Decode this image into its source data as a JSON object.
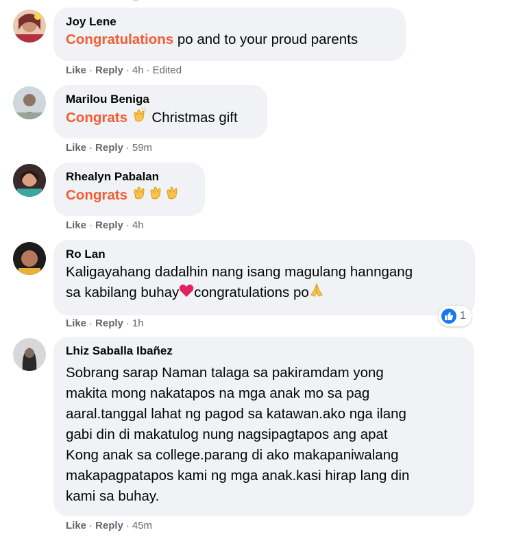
{
  "comments": [
    {
      "author": "Joy Lene",
      "highlight": "Congratulations",
      "text_after": " po and to your proud parents",
      "like": "Like",
      "reply": "Reply",
      "time": "4h",
      "edited": "Edited"
    },
    {
      "author": "Marilou Beniga",
      "highlight": "Congrats",
      "text_after": "Christmas gift",
      "like": "Like",
      "reply": "Reply",
      "time": "59m"
    },
    {
      "author": "Rhealyn Pabalan",
      "highlight": "Congrats",
      "like": "Like",
      "reply": "Reply",
      "time": "4h"
    },
    {
      "author": "Ro Lan",
      "line1": "Kaligayahang dadalhin nang isang magulang hanngang",
      "line2a": "sa kabilang buhay",
      "line2b": "congratulations po",
      "like": "Like",
      "reply": "Reply",
      "time": "1h",
      "reaction_count": "1"
    },
    {
      "author": "Lhiz Saballa Ibañez",
      "lines": [
        "Sobrang sarap Naman talaga sa pakiramdam yong",
        "makita mong nakatapos na mga anak mo sa pag",
        "aaral.tanggal lahat ng pagod sa katawan.ako nga ilang",
        "gabi din di makatulog nung nagsipagtapos ang apat",
        "Kong anak sa college.parang di ako makapaniwalang",
        "makapagpatapos kami ng mga anak.kasi hirap lang din",
        "kami sa buhay."
      ],
      "like": "Like",
      "reply": "Reply",
      "time": "45m"
    }
  ],
  "colors": {
    "highlight": "#f25c33",
    "bubble": "#f0f2f5",
    "meta": "#65676b",
    "like_blue": "#1877f2"
  },
  "icons": {
    "clap": "clapping-hands-icon",
    "heart": "red-heart-icon",
    "pray": "folded-hands-icon",
    "like": "like-reaction-icon"
  }
}
